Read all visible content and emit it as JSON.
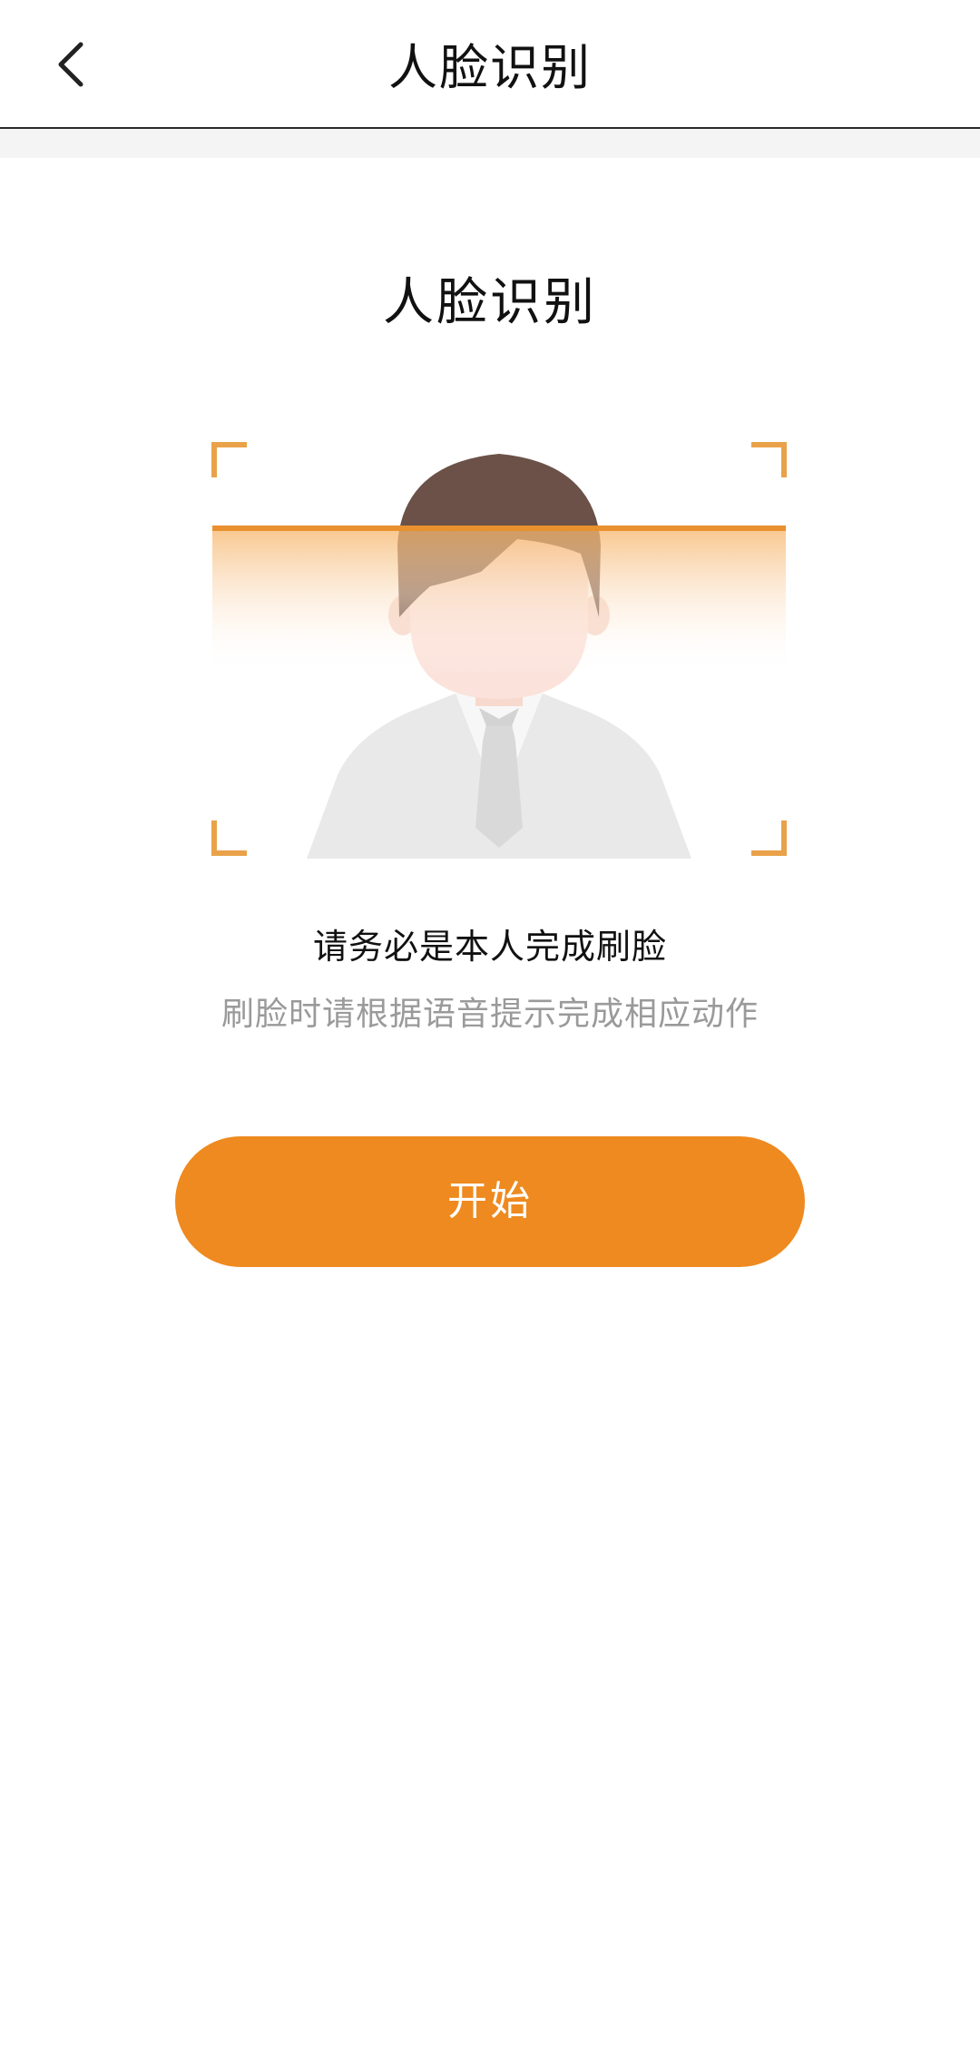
{
  "nav": {
    "title": "人脸识别",
    "back_icon": "chevron-left-icon"
  },
  "main": {
    "heading": "人脸识别",
    "illustration_icon": "face-scan-icon",
    "instruction_primary": "请务必是本人完成刷脸",
    "instruction_secondary": "刷脸时请根据语音提示完成相应动作",
    "start_button_label": "开始"
  },
  "colors": {
    "accent": "#ee8a1f",
    "frame_corners": "#e9a24a",
    "scan_line": "#e8912e",
    "hair": "#6b5148",
    "skin": "#fbe3db",
    "suit": "#e9e9e9",
    "secondary_text": "#9a9a9a"
  }
}
